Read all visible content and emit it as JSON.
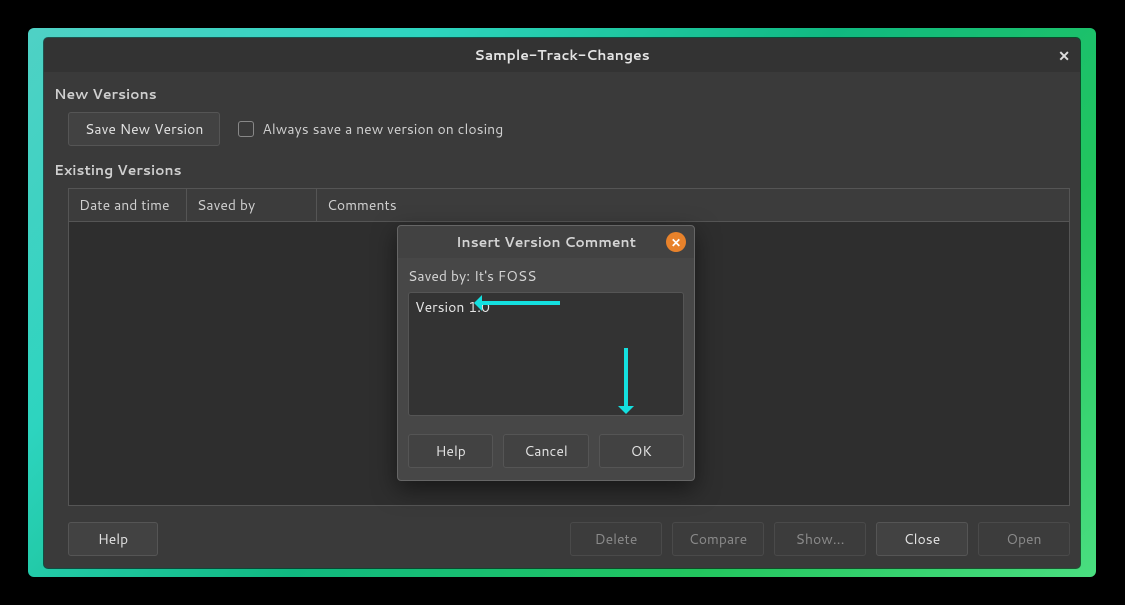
{
  "main": {
    "title": "Sample-Track-Changes",
    "new_versions_label": "New Versions",
    "save_new_version_btn": "Save New Version",
    "always_save_checkbox": "Always save a new version on closing",
    "existing_versions_label": "Existing Versions",
    "columns": {
      "datetime": "Date and time",
      "savedby": "Saved by",
      "comments": "Comments"
    },
    "buttons": {
      "help": "Help",
      "delete": "Delete",
      "compare": "Compare",
      "show": "Show...",
      "close": "Close",
      "open": "Open"
    }
  },
  "overlay": {
    "title": "Insert Version Comment",
    "saved_by": "Saved by: It's FOSS",
    "comment_value": "Version 1.0",
    "buttons": {
      "help": "Help",
      "cancel": "Cancel",
      "ok": "OK"
    }
  }
}
